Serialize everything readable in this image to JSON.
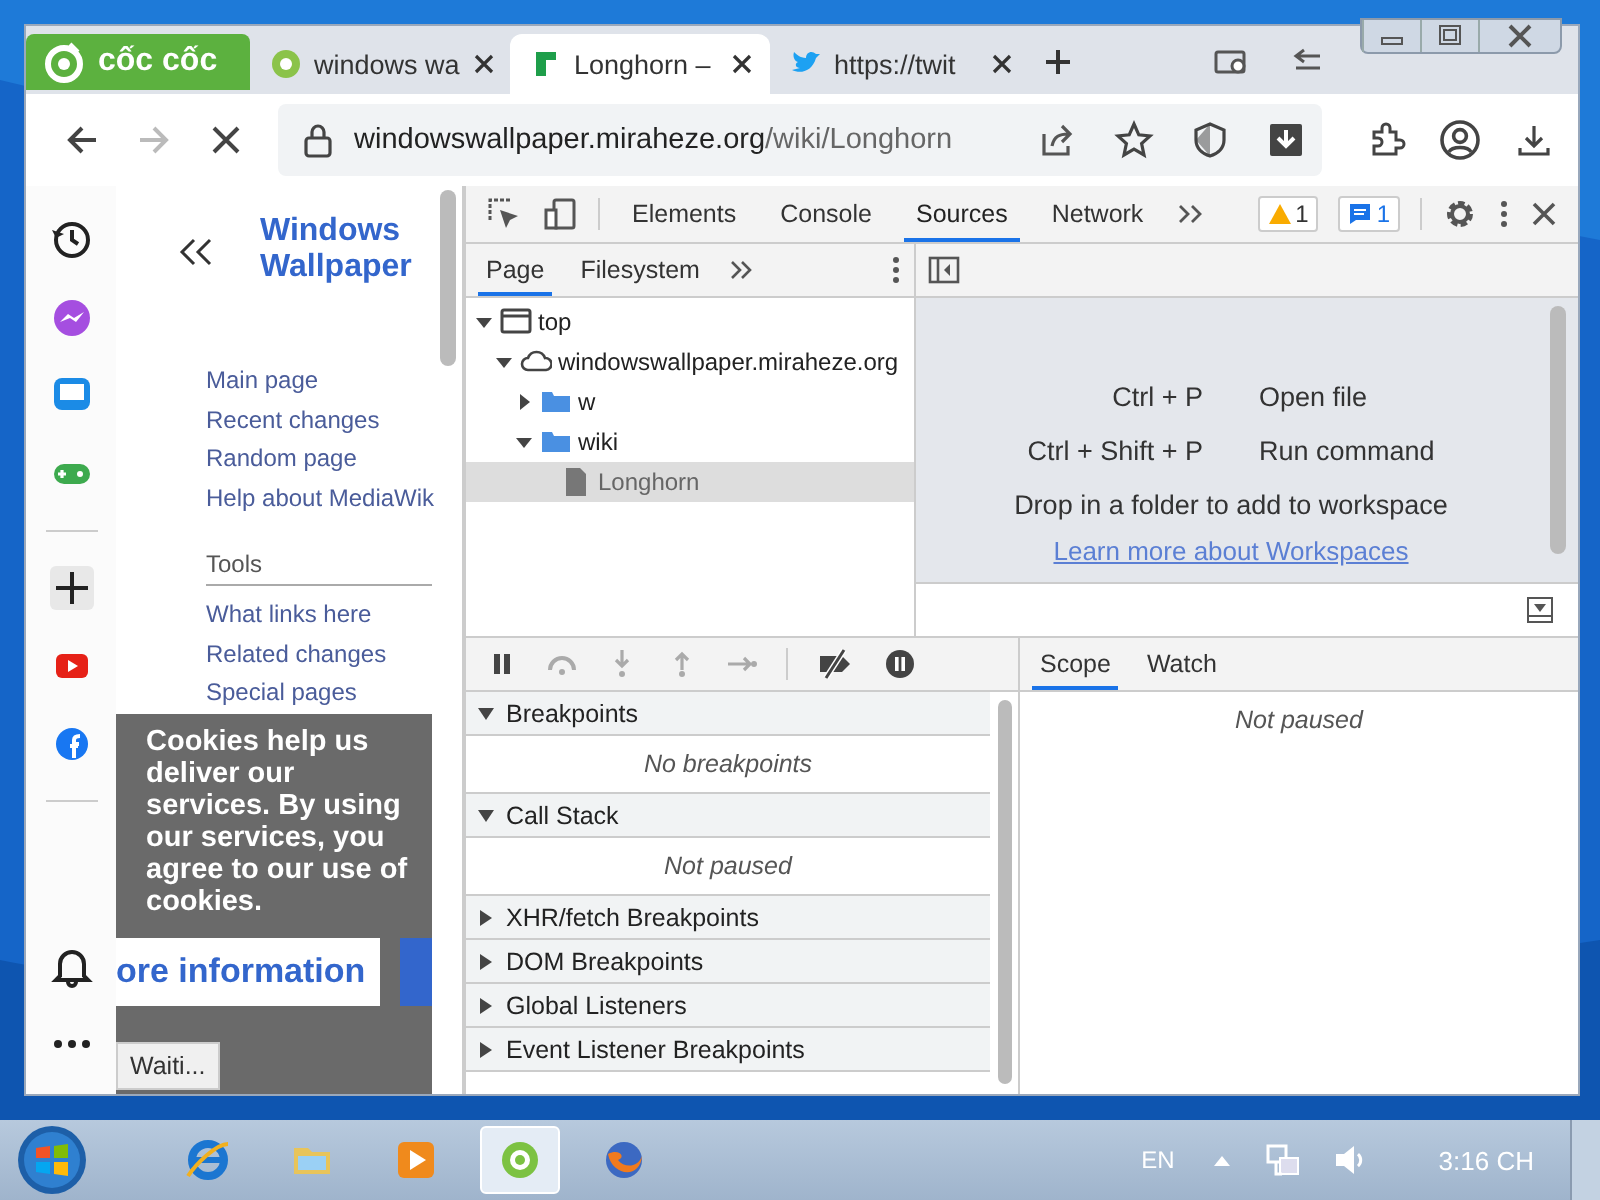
{
  "browser": {
    "logo": "cốc cốc",
    "tabs": [
      {
        "title": "windows wa",
        "selected": false,
        "kind": "leaf"
      },
      {
        "title": "Longhorn –",
        "selected": true,
        "kind": "flag"
      },
      {
        "title": "https://twit",
        "selected": false,
        "kind": "bird"
      }
    ],
    "address": {
      "host": "windowswallpaper.miraheze.org",
      "path": "/wiki/Longhorn"
    }
  },
  "page": {
    "site_title": [
      "Windows",
      "Wallpaper"
    ],
    "nav": [
      "Main page",
      "Recent changes",
      "Random page",
      "Help about MediaWik"
    ],
    "tools_heading": "Tools",
    "tools": [
      "What links here",
      "Related changes",
      "Special pages"
    ],
    "cookie_notice": {
      "text": "Cookies help us deliver our services. By using our services, you agree to our use of cookies.",
      "button": "ore information"
    },
    "status": "Waiti..."
  },
  "devtools": {
    "tabs": [
      {
        "label": "Elements",
        "selected": false
      },
      {
        "label": "Console",
        "selected": false
      },
      {
        "label": "Sources",
        "selected": true
      },
      {
        "label": "Network",
        "selected": false
      }
    ],
    "warnings": "1",
    "messages": "1",
    "navigator_tabs": [
      {
        "label": "Page",
        "selected": true
      },
      {
        "label": "Filesystem",
        "selected": false
      }
    ],
    "tree": [
      {
        "label": "top",
        "kind": "frame",
        "expanded": true,
        "selected": false,
        "children": [
          {
            "label": "windowswallpaper.miraheze.org",
            "kind": "domain",
            "expanded": true,
            "selected": false,
            "children": [
              {
                "label": "w",
                "kind": "folder",
                "expanded": false,
                "selected": false
              },
              {
                "label": "wiki",
                "kind": "folder",
                "expanded": true,
                "selected": false,
                "children": [
                  {
                    "label": "Longhorn",
                    "kind": "file",
                    "selected": true
                  }
                ]
              }
            ]
          }
        ]
      }
    ],
    "shortcuts": [
      {
        "keys": "Ctrl + P",
        "action": "Open file"
      },
      {
        "keys": "Ctrl + Shift + P",
        "action": "Run command"
      }
    ],
    "drop_hint": "Drop in a folder to add to workspace",
    "learn_more": "Learn more about Workspaces",
    "panes": [
      {
        "title": "Breakpoints",
        "expanded": true,
        "message": "No breakpoints"
      },
      {
        "title": "Call Stack",
        "expanded": true,
        "message": "Not paused"
      },
      {
        "title": "XHR/fetch Breakpoints",
        "expanded": false
      },
      {
        "title": "DOM Breakpoints",
        "expanded": false
      },
      {
        "title": "Global Listeners",
        "expanded": false
      },
      {
        "title": "Event Listener Breakpoints",
        "expanded": false
      }
    ],
    "sidebar_tabs": [
      {
        "label": "Scope",
        "selected": true
      },
      {
        "label": "Watch",
        "selected": false
      }
    ],
    "scope_message": "Not paused"
  },
  "taskbar": {
    "apps": [
      {
        "kind": "ie",
        "selected": false
      },
      {
        "kind": "folder",
        "selected": false
      },
      {
        "kind": "media",
        "selected": false
      },
      {
        "kind": "coccoc",
        "selected": true
      },
      {
        "kind": "firefox",
        "selected": false
      }
    ],
    "language": "EN",
    "clock": "3:16 CH"
  }
}
